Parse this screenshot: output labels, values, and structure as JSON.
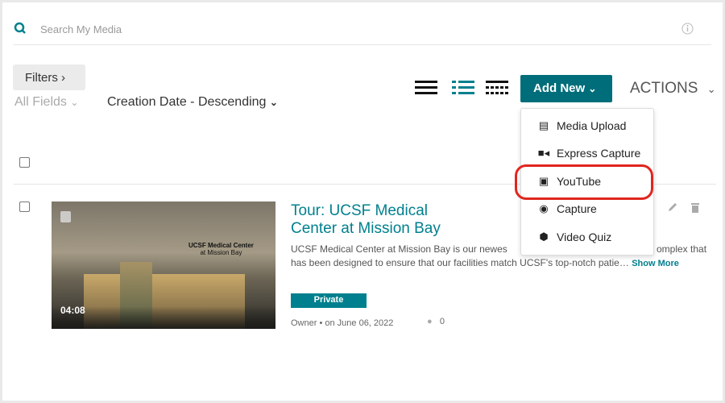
{
  "search": {
    "placeholder": "Search My Media"
  },
  "toolbar": {
    "filters": "Filters",
    "field_select": "All Fields",
    "sort_select": "Creation Date - Descending",
    "add_new": "Add New",
    "actions": "ACTIONS"
  },
  "add_new_menu": [
    {
      "label": "Media Upload",
      "icon": "film-icon"
    },
    {
      "label": "Express Capture",
      "icon": "video-camera-icon"
    },
    {
      "label": "YouTube",
      "icon": "youtube-icon",
      "highlighted": true
    },
    {
      "label": "Capture",
      "icon": "record-icon"
    },
    {
      "label": "Video Quiz",
      "icon": "cube-icon"
    }
  ],
  "entry": {
    "title": "Tour: UCSF Medical Center at Mission Bay",
    "description_line1_left": "UCSF Medical Center at Mission Bay is our newes",
    "description_line1_right": "omplex that",
    "description_line2": "has been designed to ensure that our facilities match UCSF's top-notch patie…",
    "show_more": "Show More",
    "duration": "04:08",
    "thumb_logo": "UCSF Medical Center",
    "thumb_logo_sub": "at Mission Bay",
    "badge": "Private",
    "owner": "Owner",
    "date": "on June 06, 2022",
    "comments": "0"
  },
  "colors": {
    "accent": "#006e7a",
    "link": "#00808e",
    "highlight": "#e0261f"
  }
}
